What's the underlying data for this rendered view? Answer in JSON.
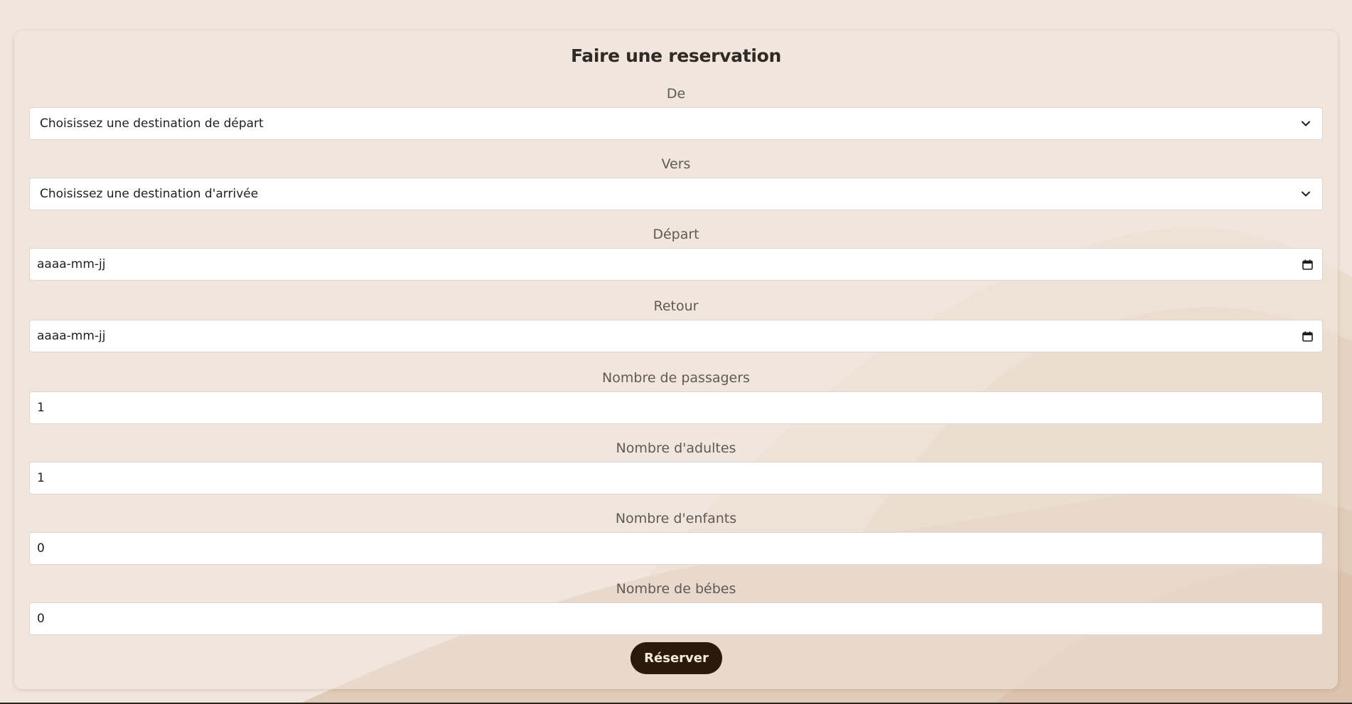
{
  "form": {
    "title": "Faire une reservation",
    "fields": [
      {
        "label": "De",
        "kind": "select",
        "value": "Choisissez une destination de départ"
      },
      {
        "label": "Vers",
        "kind": "select",
        "value": "Choisissez une destination d'arrivée"
      },
      {
        "label": "Départ",
        "kind": "date",
        "value": "aaaa-mm-jj"
      },
      {
        "label": "Retour",
        "kind": "date",
        "value": "aaaa-mm-jj"
      },
      {
        "label": "Nombre de passagers",
        "kind": "number",
        "value": "1"
      },
      {
        "label": "Nombre d'adultes",
        "kind": "number",
        "value": "1"
      },
      {
        "label": "Nombre d'enfants",
        "kind": "number",
        "value": "0"
      },
      {
        "label": "Nombre de bébes",
        "kind": "number",
        "value": "0"
      }
    ],
    "submit_label": "Réserver"
  },
  "colors": {
    "background": "#f0e6dd",
    "dune_light": "#e9d9ca",
    "dune_mid": "#e2cdb9",
    "dune_dark": "#d9c2ad",
    "button": "#2b1a0b",
    "button_text": "#f4ead8"
  },
  "icons": {
    "select_arrow": "chevron-down-icon",
    "date_picker": "calendar-icon"
  }
}
